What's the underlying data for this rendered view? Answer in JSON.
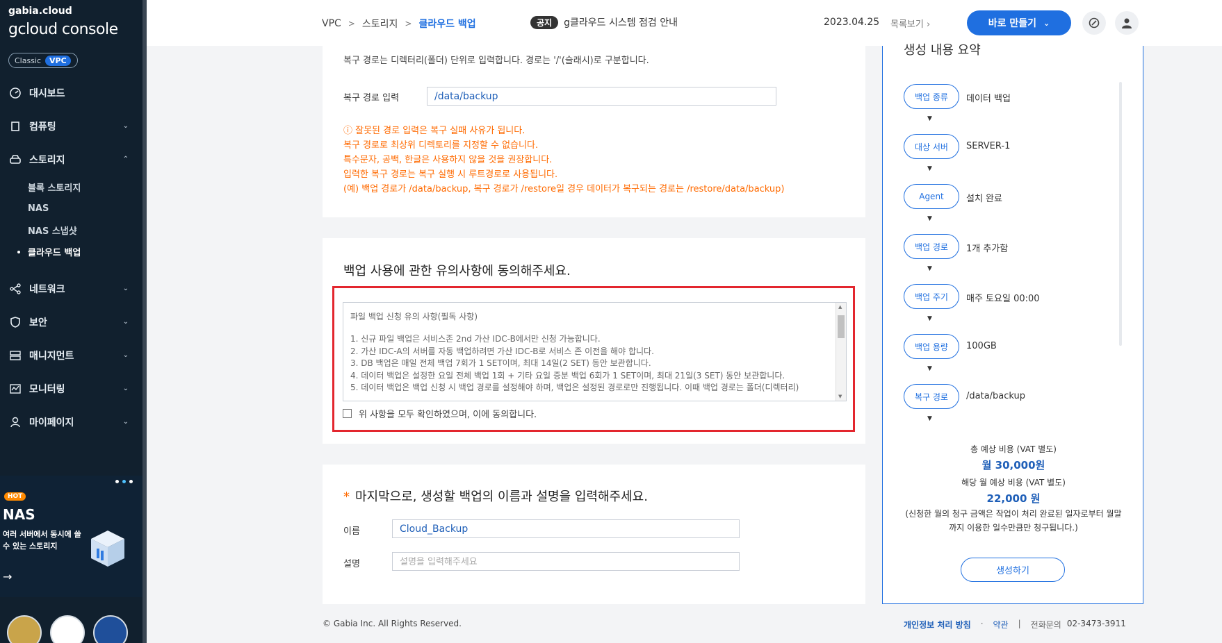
{
  "sidebar": {
    "brand_small": "gabia.cloud",
    "brand_big": "gcloud console",
    "mode": {
      "classic": "Classic",
      "vpc": "VPC"
    },
    "nav": [
      {
        "label": "대시보드"
      },
      {
        "label": "컴퓨팅"
      },
      {
        "label": "스토리지"
      },
      {
        "label": "네트워크"
      },
      {
        "label": "보안"
      },
      {
        "label": "매니지먼트"
      },
      {
        "label": "모니터링"
      },
      {
        "label": "마이페이지"
      }
    ],
    "storage_sub": [
      "블록 스토리지",
      "NAS",
      "NAS 스냅샷",
      "클라우드 백업"
    ],
    "promo": {
      "badge": "HOT",
      "title": "NAS",
      "desc": "여러 서버에서 동시에 쓸 수 있는 스토리지"
    }
  },
  "header": {
    "breadcrumb": [
      "VPC",
      "스토리지",
      "클라우드 백업"
    ],
    "notice_tag": "공지",
    "notice_text": "g클라우드 시스템 점검 안내",
    "date": "2023.04.25",
    "list_link": "목록보기",
    "create_button": "바로 만들기"
  },
  "restore": {
    "help": "복구 경로는 디렉터리(폴더) 단위로 입력합니다. 경로는 '/'(슬래시)로 구분합니다.",
    "label": "복구 경로 입력",
    "value": "/data/backup",
    "warnings": [
      "ⓘ 잘못된 경로 입력은 복구 실패 사유가 됩니다.",
      "복구 경로로 최상위 디렉토리를 지정할 수 없습니다.",
      "특수문자, 공백, 한글은 사용하지 않을 것을 권장합니다.",
      "입력한 복구 경로는 복구 실행 시 루트경로로 사용됩니다.",
      "(예) 백업 경로가 /data/backup, 복구 경로가 /restore일 경우 데이터가 복구되는 경로는 /restore/data/backup)"
    ]
  },
  "agreement": {
    "title": "백업 사용에 관한 유의사항에 동의해주세요.",
    "terms_heading": "파일 백업 신청 유의 사항(필독 사항)",
    "terms": [
      "1. 신규 파일 백업은 서비스존 2nd 가산 IDC-B에서만 신청 가능합니다.",
      "2. 가산 IDC-A의 서버를 자동 백업하려면 가산 IDC-B로 서비스 존 이전을 해야 합니다.",
      "3. DB 백업은 매일 전체 백업 7회가 1 SET이며, 최대 14일(2 SET) 동안 보관합니다.",
      "4. 데이터 백업은 설정한 요일 전체 백업 1회 + 기타 요일 증분 백업 6회가 1 SET이며, 최대 21일(3 SET) 동안 보관합니다.",
      "5. 데이터 백업은 백업 신청 시 백업 경로를 설정해야 하며, 백업은 설정된 경로로만 진행됩니다. 이때 백업 경로는 폴더(디렉터리)"
    ],
    "checkbox_label": "위 사항을 모두 확인하였으며, 이에 동의합니다."
  },
  "naming": {
    "required_mark": "*",
    "title": "마지막으로, 생성할 백업의 이름과 설명을 입력해주세요.",
    "name_label": "이름",
    "name_value": "Cloud_Backup",
    "desc_label": "설명",
    "desc_placeholder": "설명을 입력해주세요"
  },
  "summary": {
    "title": "생성 내용 요약",
    "items": [
      {
        "key": "백업 종류",
        "value": "데이터 백업"
      },
      {
        "key": "대상 서버",
        "value": "SERVER-1"
      },
      {
        "key": "Agent",
        "value": "설치 완료"
      },
      {
        "key": "백업 경로",
        "value": "1개 추가함"
      },
      {
        "key": "백업 주기",
        "value": "매주 토요일 00:00"
      },
      {
        "key": "백업 용량",
        "value": "100GB"
      },
      {
        "key": "복구 경로",
        "value": "/data/backup"
      }
    ],
    "total_label": "총 예상 비용 (VAT 별도)",
    "total_value": "월 30,000원",
    "month_label": "해당 월 예상 비용 (VAT 별도)",
    "month_value": "22,000 원",
    "note": "(신청한 월의 청구 금액은 작업이 처리 완료된 일자로부터 월말까지 이용한 일수만큼만 청구됩니다.)",
    "create_button": "생성하기"
  },
  "footer": {
    "copyright": "© Gabia Inc. All Rights Reserved.",
    "privacy": "개인정보 처리 방침",
    "terms": "약관",
    "contact_label": "전화문의",
    "contact_number": "02-3473-3911"
  },
  "colors": {
    "primary": "#1f6fe0",
    "warning": "#ff6a00",
    "highlight": "#e3262e",
    "sidebar": "#11202e"
  }
}
